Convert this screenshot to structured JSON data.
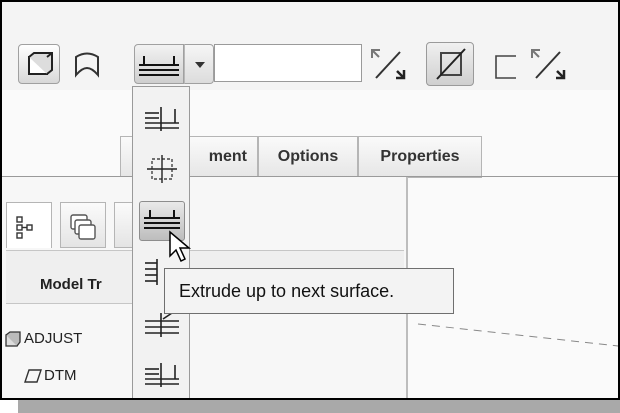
{
  "toolbar": {
    "buttons": [
      {
        "icon": "solid-icon"
      },
      {
        "icon": "surface-icon"
      },
      {
        "icon": "depth-blind-icon"
      },
      {
        "icon": "dropdown-arrow-icon"
      },
      {
        "icon": "flip-direction-icon"
      },
      {
        "icon": "remove-material-icon"
      },
      {
        "icon": "thicken-icon"
      },
      {
        "icon": "flip-thicken-icon"
      }
    ],
    "depth_value": ""
  },
  "tabs": {
    "placement": "ment",
    "options": "Options",
    "properties": "Properties"
  },
  "panel": {
    "header": "Model Tr",
    "items": [
      "ADJUST",
      "DTM"
    ]
  },
  "depth_menu": {
    "options": [
      {
        "icon": "blind-depth-icon"
      },
      {
        "icon": "symmetric-depth-icon"
      },
      {
        "icon": "to-next-icon",
        "selected": true
      },
      {
        "icon": "through-all-icon"
      },
      {
        "icon": "through-until-icon"
      },
      {
        "icon": "to-selected-icon"
      }
    ]
  },
  "tooltip": {
    "text": "Extrude up to next surface."
  },
  "colors": {
    "frame": "#000000",
    "toolbar_bg": "#f4f4f4",
    "tooltip_bg": "#f3f3f3",
    "selected_bg": "#bdbdbd"
  }
}
